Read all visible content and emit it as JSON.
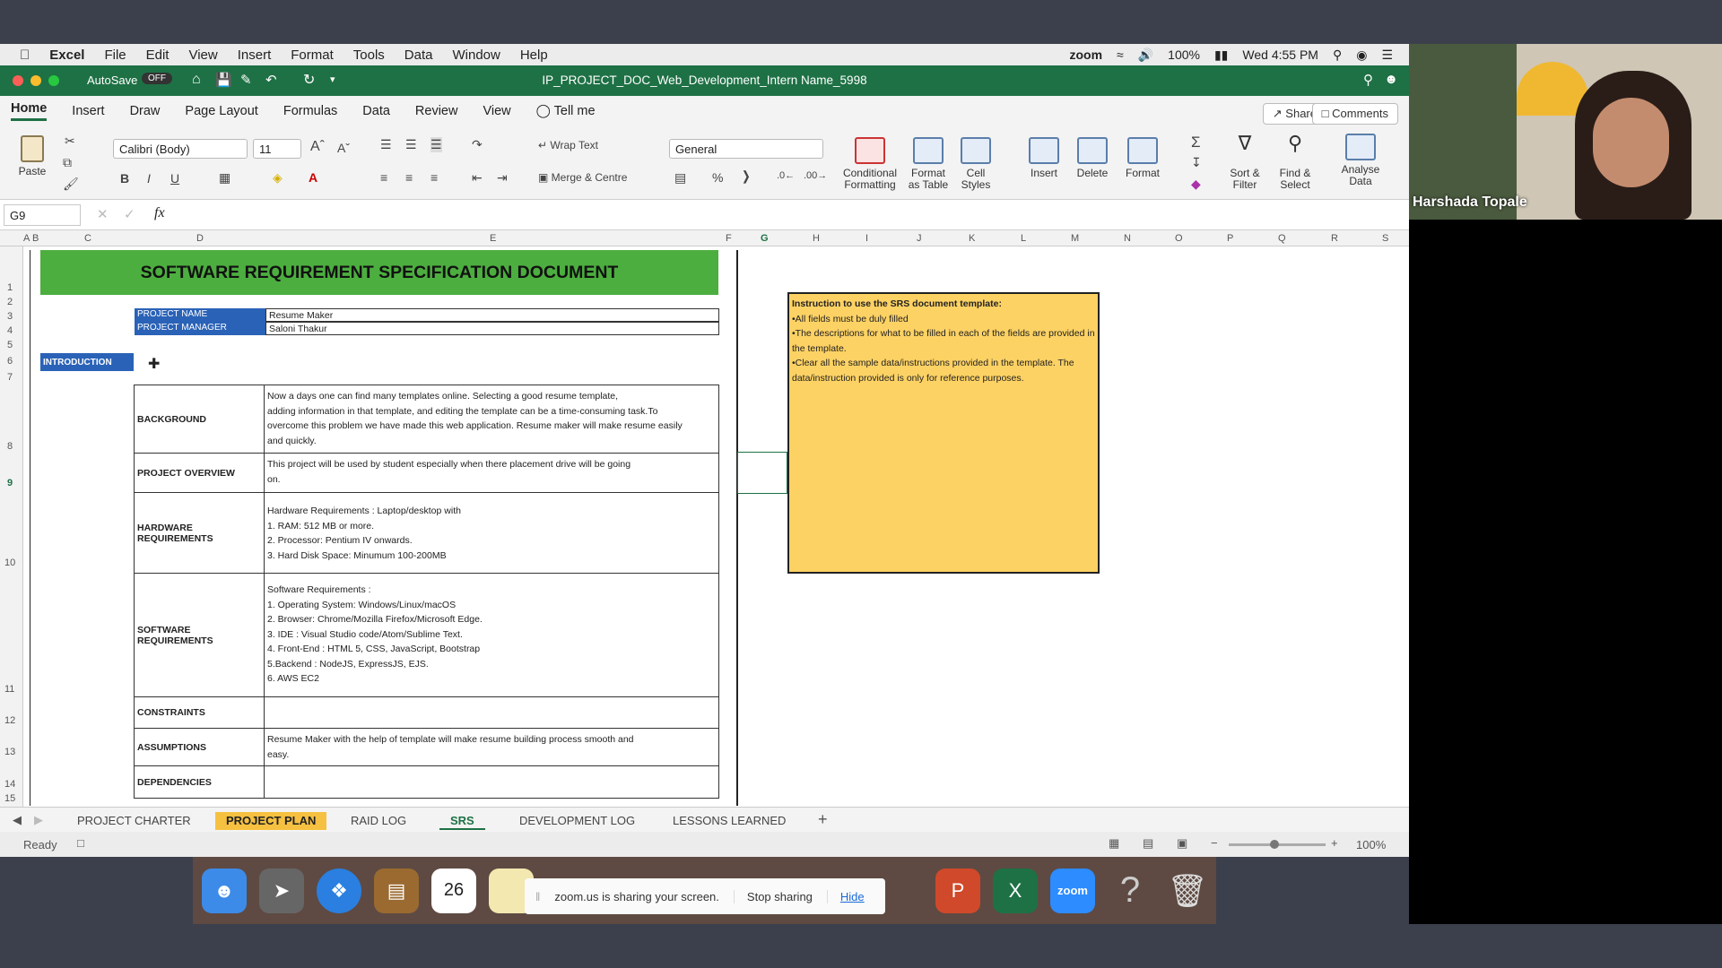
{
  "mac_menubar": {
    "apple": "",
    "items": [
      "Excel",
      "File",
      "Edit",
      "View",
      "Insert",
      "Format",
      "Tools",
      "Data",
      "Window",
      "Help"
    ],
    "zoom": "zoom",
    "battery": "100%",
    "clock": "Wed 4:55 PM"
  },
  "titlebar": {
    "autosave": "AutoSave",
    "autosave_state": "OFF",
    "title": "IP_PROJECT_DOC_Web_Development_Intern Name_5998"
  },
  "ribbon_tabs": {
    "tabs": [
      "Home",
      "Insert",
      "Draw",
      "Page Layout",
      "Formulas",
      "Data",
      "Review",
      "View"
    ],
    "tell_me": "Tell me",
    "share": "Share",
    "comments": "Comments"
  },
  "ribbon": {
    "paste": "Paste",
    "font_name": "Calibri (Body)",
    "font_size": "11",
    "wrap_text": "Wrap Text",
    "merge_centre": "Merge & Centre",
    "number_format": "General",
    "conditional_formatting": "Conditional Formatting",
    "format_as_table": "Format as Table",
    "cell_styles": "Cell Styles",
    "insert": "Insert",
    "delete": "Delete",
    "format": "Format",
    "sort_filter": "Sort & Filter",
    "find_select": "Find & Select",
    "analyse_data": "Analyse Data"
  },
  "formula_bar": {
    "name_box": "G9",
    "fx": "fx",
    "formula": ""
  },
  "columns": [
    "A",
    "B",
    "C",
    "D",
    "E",
    "F",
    "G",
    "H",
    "I",
    "J",
    "K",
    "L",
    "M",
    "N",
    "O",
    "P",
    "Q",
    "R",
    "S"
  ],
  "rows": [
    "1",
    "2",
    "3",
    "4",
    "5",
    "6",
    "7",
    "8",
    "9",
    "10",
    "11",
    "12",
    "13",
    "14",
    "15"
  ],
  "sheet": {
    "title": "SOFTWARE REQUIREMENT SPECIFICATION DOCUMENT",
    "project_name_label": "PROJECT NAME",
    "project_name": "Resume Maker",
    "project_manager_label": "PROJECT MANAGER",
    "project_manager": "Saloni Thakur",
    "introduction": "INTRODUCTION",
    "sections": [
      {
        "label": "BACKGROUND",
        "value": "Now a days one can find many templates online. Selecting a good resume template,\nadding information in that template, and editing the template can be a time-consuming task.To\novercome this problem we have made this web application. Resume maker will make resume easily\nand quickly."
      },
      {
        "label": "PROJECT OVERVIEW",
        "value": "This project will be used by student especially when there placement drive will be going\non."
      },
      {
        "label": "HARDWARE REQUIREMENTS",
        "value": "Hardware Requirements : Laptop/desktop with\n1. RAM: 512 MB or more.\n2. Processor: Pentium IV onwards.\n3. Hard Disk Space: Minumum 100-200MB"
      },
      {
        "label": "SOFTWARE REQUIREMENTS",
        "value": "Software Requirements :\n1. Operating System: Windows/Linux/macOS\n2. Browser: Chrome/Mozilla Firefox/Microsoft Edge.\n3. IDE : Visual Studio code/Atom/Sublime Text.\n4. Front-End : HTML 5, CSS, JavaScript, Bootstrap\n5.Backend : NodeJS, ExpressJS, EJS.\n6. AWS EC2"
      },
      {
        "label": "CONSTRAINTS",
        "value": ""
      },
      {
        "label": "ASSUMPTIONS",
        "value": "Resume Maker with the help of template will make resume building process smooth and\neasy."
      },
      {
        "label": "DEPENDENCIES",
        "value": ""
      }
    ],
    "instructions": {
      "heading": "Instruction to use the SRS document template:",
      "lines": [
        "•All fields must be duly filled",
        "•The descriptions for what to be filled in each of the fields are provided in the template.",
        "•Clear all the sample data/instructions provided in the template. The data/instruction provided is only for reference purposes."
      ]
    }
  },
  "sheet_tabs": [
    "PROJECT CHARTER",
    "PROJECT PLAN",
    "RAID LOG",
    "SRS",
    "DEVELOPMENT LOG",
    "LESSONS LEARNED"
  ],
  "status": {
    "ready": "Ready",
    "zoom": "100%"
  },
  "dock": {
    "calendar_day": "26",
    "zoom_app": "zoom"
  },
  "share_bar": {
    "text": "zoom.us is sharing your screen.",
    "stop": "Stop sharing",
    "hide": "Hide"
  },
  "webcam": {
    "name": "Harshada Topale"
  },
  "colors": {
    "excel_green": "#1e7145",
    "banner_green": "#4cae3f",
    "label_blue": "#2a62b7",
    "note_yellow": "#fdd264",
    "active_tab": "#f6c141"
  }
}
